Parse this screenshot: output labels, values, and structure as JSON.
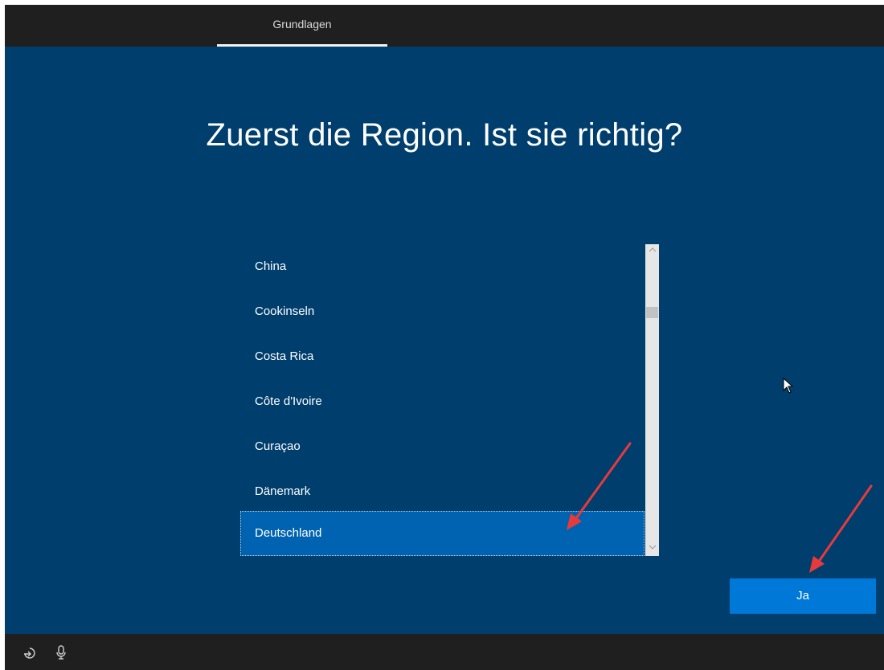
{
  "header": {
    "tab_label": "Grundlagen"
  },
  "main": {
    "headline": "Zuerst die Region. Ist sie richtig?"
  },
  "region_list": {
    "items": [
      {
        "label": "China",
        "selected": false
      },
      {
        "label": "Cookinseln",
        "selected": false
      },
      {
        "label": "Costa Rica",
        "selected": false
      },
      {
        "label": "Côte d'Ivoire",
        "selected": false
      },
      {
        "label": "Curaçao",
        "selected": false
      },
      {
        "label": "Dänemark",
        "selected": false
      },
      {
        "label": "Deutschland",
        "selected": true
      }
    ]
  },
  "actions": {
    "confirm_label": "Ja"
  },
  "taskbar": {
    "icons": [
      "accessibility-icon",
      "microphone-icon"
    ]
  },
  "colors": {
    "background": "#003e6e",
    "bar": "#1f1f1f",
    "accent": "#0078d7",
    "selection": "#0063b1",
    "annotation_arrow": "#e83a3a"
  }
}
